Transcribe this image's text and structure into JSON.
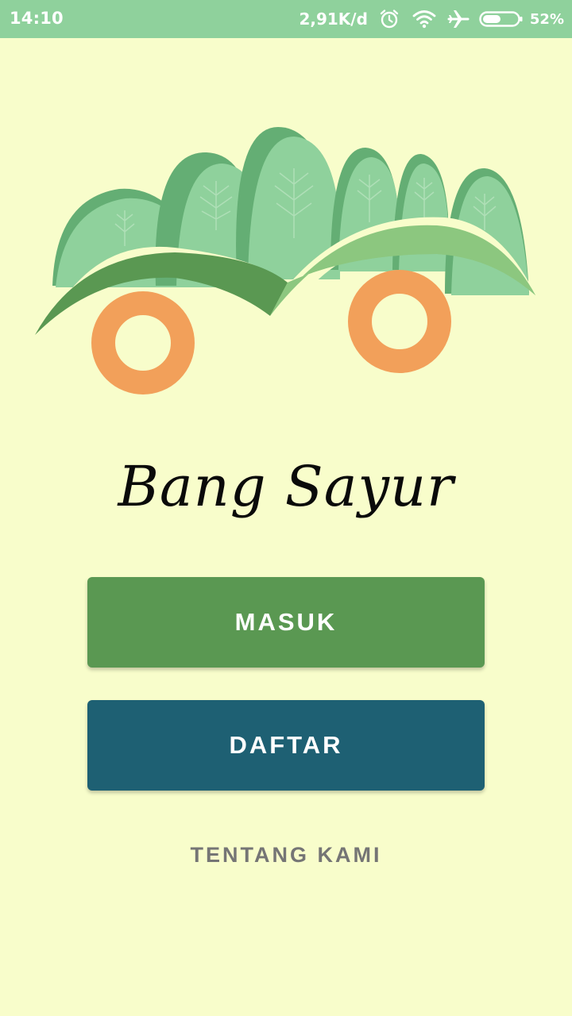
{
  "status_bar": {
    "time": "14:10",
    "network_speed": "2,91K/d",
    "battery_percent": "52%",
    "battery_level": 0.52,
    "icons": [
      "alarm-icon",
      "wifi-icon",
      "airplane-icon",
      "battery-icon"
    ]
  },
  "app": {
    "title": "Bang Sayur",
    "logo": "vegetable-truck-logo"
  },
  "actions": {
    "login_label": "MASUK",
    "register_label": "DAFTAR",
    "about_label": "TENTANG KAMI"
  },
  "colors": {
    "background": "#F8FDCB",
    "status_bar": "#8FD19C",
    "login_button": "#5A9852",
    "register_button": "#1E6073",
    "about_text": "#757575",
    "wheel": "#F2A05A"
  }
}
